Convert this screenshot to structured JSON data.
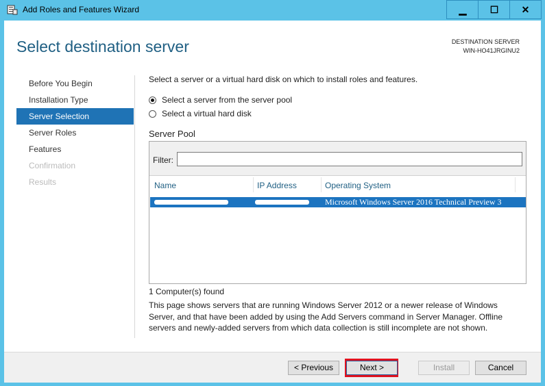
{
  "window": {
    "title": "Add Roles and Features Wizard",
    "minimize_glyph": "▁",
    "maximize_glyph": "☐",
    "close_glyph": "✕"
  },
  "header": {
    "page_title": "Select destination server",
    "destination_label": "DESTINATION SERVER",
    "destination_value": "WIN-HO41JRGINU2"
  },
  "nav": {
    "items": [
      {
        "label": "Before You Begin",
        "state": "normal"
      },
      {
        "label": "Installation Type",
        "state": "normal"
      },
      {
        "label": "Server Selection",
        "state": "active"
      },
      {
        "label": "Server Roles",
        "state": "normal"
      },
      {
        "label": "Features",
        "state": "normal"
      },
      {
        "label": "Confirmation",
        "state": "disabled"
      },
      {
        "label": "Results",
        "state": "disabled"
      }
    ]
  },
  "main": {
    "intro": "Select a server or a virtual hard disk on which to install roles and features.",
    "radio_pool": "Select a server from the server pool",
    "radio_vhd": "Select a virtual hard disk",
    "selected_option": "pool",
    "pool_label": "Server Pool",
    "filter_label": "Filter:",
    "filter_value": "",
    "columns": [
      "Name",
      "IP Address",
      "Operating System"
    ],
    "rows": [
      {
        "name": "",
        "ip": "",
        "os": "Microsoft Windows Server 2016 Technical Preview 3",
        "selected": true
      }
    ],
    "found_text": "1 Computer(s) found",
    "description": "This page shows servers that are running Windows Server 2012 or a newer release of Windows Server, and that have been added by using the Add Servers command in Server Manager. Offline servers and newly-added servers from which data collection is still incomplete are not shown."
  },
  "footer": {
    "previous": "< Previous",
    "next": "Next >",
    "install": "Install",
    "cancel": "Cancel"
  },
  "colors": {
    "titlebar": "#5bc2e7",
    "accent": "#1f73b5",
    "selection": "#1c74c0",
    "highlight": "#e0121f",
    "title_text": "#1f5f83"
  }
}
